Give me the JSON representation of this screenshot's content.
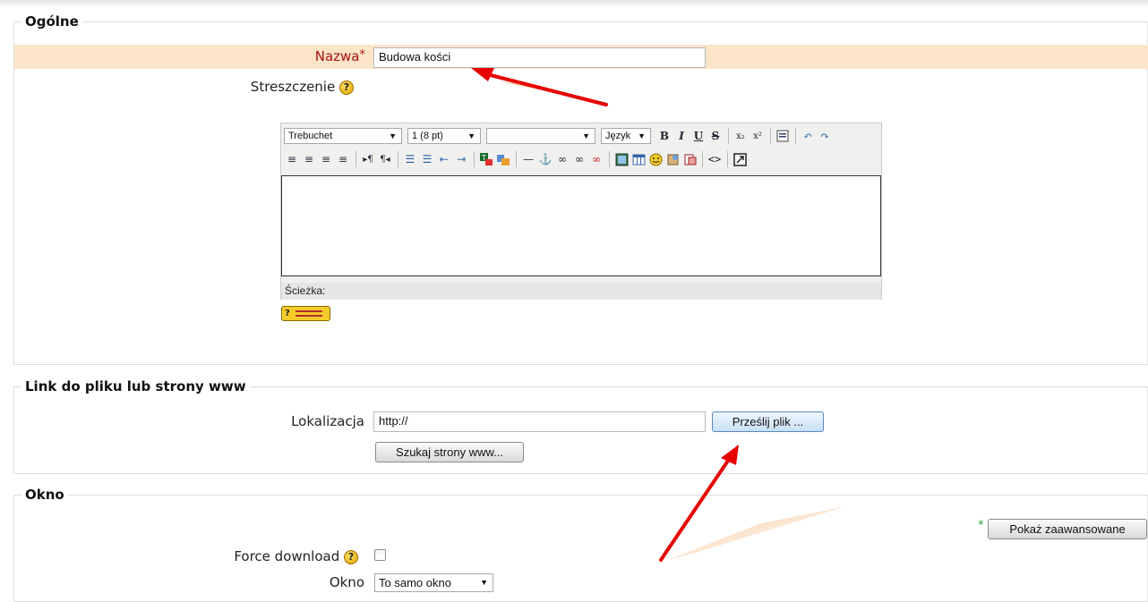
{
  "sections": {
    "general": {
      "legend": "Ogólne",
      "name_label": "Nazwa",
      "name_required_mark": "*",
      "name_value": "Budowa kości",
      "summary_label": "Streszczenie",
      "help_glyph": "?",
      "editor": {
        "font_family": "Trebuchet",
        "font_size": "1 (8 pt)",
        "format_value": "",
        "language_label": "Język",
        "path_label": "Ścieżka:",
        "toolbar_row1_icons": [
          "bold-icon",
          "italic-icon",
          "underline-icon",
          "strikethrough-icon",
          "subscript-icon",
          "superscript-icon",
          "clean-word-icon",
          "undo-icon",
          "redo-icon"
        ],
        "toolbar_row2_icons": [
          "align-left-icon",
          "align-center-icon",
          "align-right-icon",
          "align-justify-icon",
          "ltr-icon",
          "rtl-icon",
          "ordered-list-icon",
          "unordered-list-icon",
          "outdent-icon",
          "indent-icon",
          "text-color-icon",
          "background-color-icon",
          "horizontal-rule-icon",
          "anchor-icon",
          "link-icon",
          "unlink-icon",
          "nolink-icon",
          "image-icon",
          "table-icon",
          "smiley-icon",
          "spellcheck-icon",
          "search-replace-icon",
          "html-source-icon",
          "fullscreen-icon"
        ]
      }
    },
    "link": {
      "legend": "Link do pliku lub strony www",
      "location_label": "Lokalizacja",
      "location_value": "http://",
      "upload_button": "Prześlij plik ...",
      "search_button": "Szukaj strony www..."
    },
    "window": {
      "legend": "Okno",
      "advanced_star": "*",
      "advanced_button": "Pokaż zaawansowane",
      "force_download_label": "Force download",
      "window_label": "Okno",
      "window_value": "To samo okno"
    }
  },
  "colors": {
    "required_row_bg": "#fbe4c8",
    "required_label": "#aa1111",
    "annotation_arrow": "#e60000"
  }
}
